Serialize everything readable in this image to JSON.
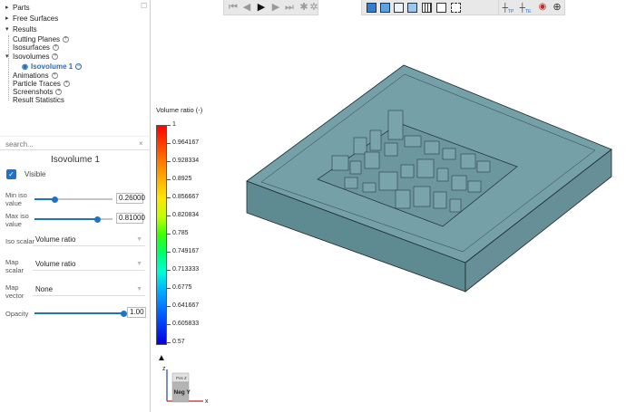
{
  "tree": {
    "items": [
      {
        "label": "Parts",
        "caret": "▸",
        "plus": false
      },
      {
        "label": "Free Surfaces",
        "caret": "▸",
        "plus": false
      },
      {
        "label": "Results",
        "caret": "▾",
        "plus": false
      },
      {
        "label": "Cutting Planes",
        "caret": "",
        "plus": true
      },
      {
        "label": "Isosurfaces",
        "caret": "",
        "plus": true
      },
      {
        "label": "Isovolumes",
        "caret": "",
        "plus": true
      },
      {
        "label": "Isovolume 1",
        "caret": "",
        "plus": false
      },
      {
        "label": "Animations",
        "caret": "",
        "plus": true
      },
      {
        "label": "Particle Traces",
        "caret": "",
        "plus": true
      },
      {
        "label": "Screenshots",
        "caret": "",
        "plus": true
      },
      {
        "label": "Result Statistics",
        "caret": "",
        "plus": false
      }
    ],
    "lock_icon": "lock-icon"
  },
  "search": {
    "placeholder": "search...",
    "clear": "×"
  },
  "properties": {
    "title": "Isovolume 1",
    "visible_label": "Visible",
    "visible_checked": true,
    "min_iso_label": "Min iso value",
    "min_iso_value": "0.26000",
    "min_iso_fraction": 0.26,
    "max_iso_label": "Max iso value",
    "max_iso_value": "0.81000",
    "max_iso_fraction": 0.81,
    "iso_scalar_label": "Iso scalar",
    "iso_scalar_value": "Volume ratio",
    "map_scalar_label": "Map scalar",
    "map_scalar_value": "Volume ratio",
    "map_vector_label": "Map vector",
    "map_vector_value": "None",
    "opacity_label": "Opacity",
    "opacity_value": "1.00",
    "opacity_fraction": 1.0
  },
  "toolbar": {
    "playback_icons": [
      "skip-first-icon",
      "step-back-icon",
      "play-icon",
      "step-forward-icon",
      "skip-last-icon",
      "walk-icon",
      "run-icon"
    ],
    "view_icons": [
      "shaded-cube-icon",
      "flat-cube-icon",
      "wireframe-cube-icon",
      "mesh-cube-icon",
      "grid-cube-icon",
      "outline-cube-icon",
      "bounding-box-icon"
    ],
    "extra_icons": [
      "pin-icon",
      "axis-tp-icon",
      "axis-te-icon",
      "probe-icon",
      "target-icon"
    ],
    "tp_label": "TP",
    "te_label": "TE"
  },
  "legend": {
    "title": "Volume ratio (-)",
    "labels": [
      "1",
      "0.964167",
      "0.928334",
      "0.8925",
      "0.856667",
      "0.820834",
      "0.785",
      "0.749167",
      "0.713333",
      "0.6775",
      "0.641667",
      "0.605833",
      "0.57"
    ]
  },
  "triad": {
    "z_label": "z",
    "x_label": "x",
    "pos_z_label": "Pos Z",
    "neg_y_label": "Neg Y"
  },
  "colors": {
    "accent": "#1e73c8",
    "model_fill": "#6f9aa2",
    "model_dark": "#5b858d"
  }
}
